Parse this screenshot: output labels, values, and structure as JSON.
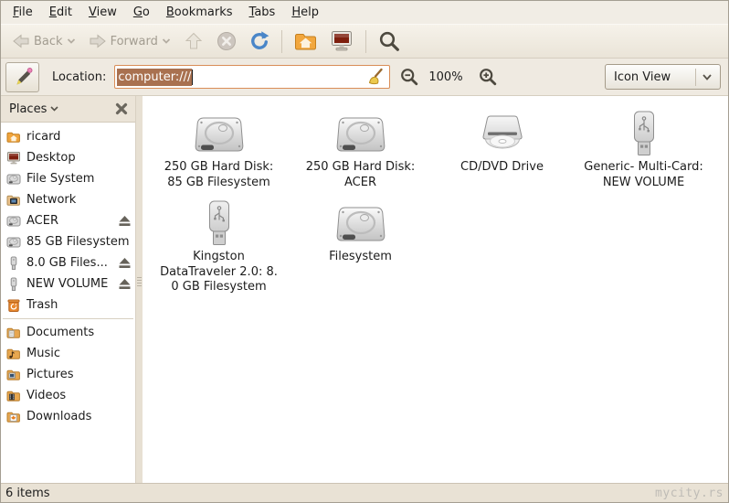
{
  "colors": {
    "accent": "#e8862c",
    "selection": "#a97150",
    "entry_border": "#d98d57"
  },
  "menu": {
    "items": [
      {
        "label": "File"
      },
      {
        "label": "Edit"
      },
      {
        "label": "View"
      },
      {
        "label": "Go"
      },
      {
        "label": "Bookmarks"
      },
      {
        "label": "Tabs"
      },
      {
        "label": "Help"
      }
    ]
  },
  "toolbar": {
    "back_label": "Back",
    "forward_label": "Forward",
    "back_enabled": false,
    "forward_enabled": false
  },
  "location": {
    "label": "Location:",
    "value": "computer:///",
    "zoom_level": "100%",
    "view_mode": "Icon View"
  },
  "sidebar": {
    "header": "Places",
    "items": [
      {
        "label": "ricard",
        "icon": "home-folder-icon"
      },
      {
        "label": "Desktop",
        "icon": "desktop-icon"
      },
      {
        "label": "File System",
        "icon": "harddisk-icon"
      },
      {
        "label": "Network",
        "icon": "network-folder-icon"
      },
      {
        "label": "ACER",
        "icon": "harddisk-icon",
        "eject": true
      },
      {
        "label": "85 GB Filesystem",
        "icon": "harddisk-icon"
      },
      {
        "label": "8.0 GB Files...",
        "icon": "usb-drive-icon",
        "eject": true
      },
      {
        "label": "NEW VOLUME",
        "icon": "usb-drive-icon",
        "eject": true
      },
      {
        "label": "Trash",
        "icon": "trash-icon"
      },
      {
        "separator": true
      },
      {
        "label": "Documents",
        "icon": "folder-documents-icon"
      },
      {
        "label": "Music",
        "icon": "folder-music-icon"
      },
      {
        "label": "Pictures",
        "icon": "folder-pictures-icon"
      },
      {
        "label": "Videos",
        "icon": "folder-videos-icon"
      },
      {
        "label": "Downloads",
        "icon": "folder-downloads-icon"
      }
    ]
  },
  "main": {
    "view": "icon-grid",
    "items": [
      {
        "label": "250 GB Hard Disk:\n85 GB Filesystem",
        "icon": "harddisk-large-icon"
      },
      {
        "label": "250 GB Hard Disk:\nACER",
        "icon": "harddisk-large-icon"
      },
      {
        "label": "CD/DVD Drive",
        "icon": "cdrom-large-icon"
      },
      {
        "label": "Generic- Multi-Card:\nNEW VOLUME",
        "icon": "usb-large-icon"
      },
      {
        "label": "Kingston\nDataTraveler 2.0: 8.\n0 GB Filesystem",
        "icon": "usb-large-icon"
      },
      {
        "label": "Filesystem",
        "icon": "harddisk-large-icon"
      }
    ]
  },
  "status": {
    "text": "6 items",
    "watermark": "mycity.rs"
  }
}
